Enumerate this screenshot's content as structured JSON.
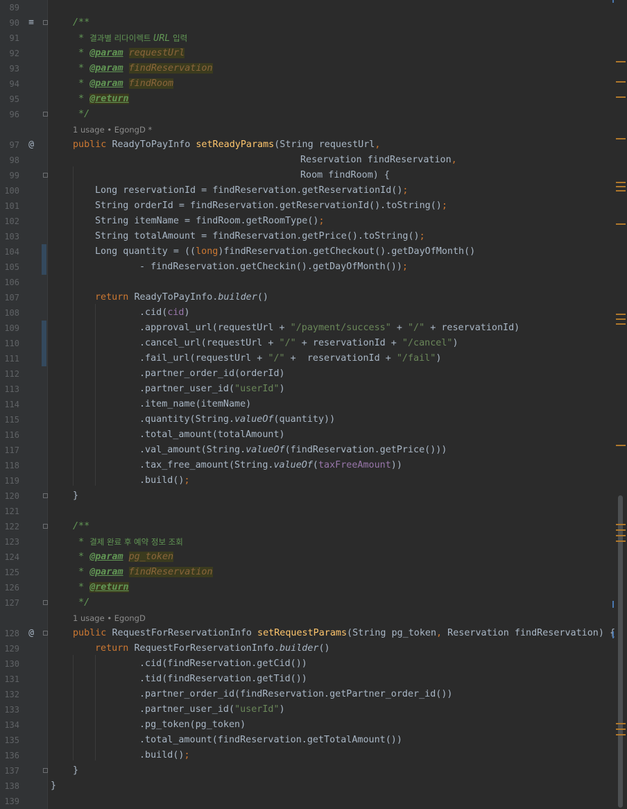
{
  "editor": {
    "hints": {
      "h1": "1 usage   • EgongD *",
      "h2": "1 usage   • EgongD"
    },
    "lines": {
      "l89": "89",
      "l90": "90",
      "l91": "91",
      "l92": "92",
      "l93": "93",
      "l94": "94",
      "l95": "95",
      "l96": "96",
      "l97": "97",
      "l98": "98",
      "l99": "99",
      "l100": "100",
      "l101": "101",
      "l102": "102",
      "l103": "103",
      "l104": "104",
      "l105": "105",
      "l106": "106",
      "l107": "107",
      "l108": "108",
      "l109": "109",
      "l110": "110",
      "l111": "111",
      "l112": "112",
      "l113": "113",
      "l114": "114",
      "l115": "115",
      "l116": "116",
      "l117": "117",
      "l118": "118",
      "l119": "119",
      "l120": "120",
      "l121": "121",
      "l122": "122",
      "l123": "123",
      "l124": "124",
      "l125": "125",
      "l126": "126",
      "l127": "127",
      "l128": "128",
      "l129": "129",
      "l130": "130",
      "l131": "131",
      "l132": "132",
      "l133": "133",
      "l134": "134",
      "l135": "135",
      "l136": "136",
      "l137": "137",
      "l138": "138",
      "l139": "139"
    },
    "t": {
      "c90": "/**",
      "c91a": " * ",
      "c91b": "결과별 리다이렉트 ",
      "c91c": "URL",
      "c91d": " 입력",
      "c92a": " * ",
      "c92b": "@param",
      "c92c": "requestUrl",
      "c93a": " * ",
      "c93b": "@param",
      "c93c": "findReservation",
      "c94a": " * ",
      "c94b": "@param",
      "c94c": "findRoom",
      "c95a": " * ",
      "c95b": "@return",
      "c96": " */",
      "k97": "public ",
      "t97": "ReadyToPayInfo ",
      "f97": "setReadyParams",
      "r97": "(String requestUrl",
      "p97": ",",
      "t98": "Reservation findReservation",
      "p98": ",",
      "t99": "Room findRoom) {",
      "a100": "Long reservationId = findReservation.getReservationId()",
      "b100": ";",
      "a101": "String orderId = findReservation.getReservationId().toString()",
      "b101": ";",
      "a102": "String itemName = findRoom.getRoomType()",
      "b102": ";",
      "a103": "String totalAmount = findReservation.getPrice().toString()",
      "b103": ";",
      "a104": "Long quantity = ((",
      "k104": "long",
      "b104": ")findReservation.getCheckout().getDayOfMonth()",
      "a105": "- findReservation.getCheckin().getDayOfMonth())",
      "b105": ";",
      "k107": "return ",
      "a107": "ReadyToPayInfo.",
      "i107": "builder",
      "b107": "()",
      "a108": ".cid(",
      "f108": "cid",
      "b108": ")",
      "a109": ".approval_url(requestUrl + ",
      "s109a": "\"/payment/success\"",
      "b109": " + ",
      "s109b": "\"/\"",
      "c109": " + reservationId)",
      "a110": ".cancel_url(requestUrl + ",
      "s110a": "\"/\"",
      "b110": " + reservationId + ",
      "s110b": "\"/cancel\"",
      "c110": ")",
      "a111": ".fail_url(requestUrl + ",
      "s111a": "\"/\"",
      "b111": " +  reservationId + ",
      "s111b": "\"/fail\"",
      "c111": ")",
      "a112": ".partner_order_id(orderId)",
      "a113": ".partner_user_id(",
      "s113": "\"userId\"",
      "b113": ")",
      "a114": ".item_name(itemName)",
      "a115": ".quantity(String.",
      "i115": "valueOf",
      "b115": "(quantity))",
      "a116": ".total_amount(totalAmount)",
      "a117": ".val_amount(String.",
      "i117": "valueOf",
      "b117": "(findReservation.getPrice()))",
      "a118": ".tax_free_amount(String.",
      "i118": "valueOf",
      "b118": "(",
      "f118": "taxFreeAmount",
      "c118": "))",
      "a119": ".build()",
      "b119": ";",
      "a120": "}",
      "c122": "/**",
      "c123a": " * ",
      "c123b": "결제 완료 후 예약 정보 조회",
      "c124a": " * ",
      "c124b": "@param",
      "c124c": "pg_token",
      "c125a": " * ",
      "c125b": "@param",
      "c125c": "findReservation",
      "c126a": " * ",
      "c126b": "@return",
      "c127": " */",
      "k128": "public ",
      "t128": "RequestForReservationInfo ",
      "f128": "setRequestParams",
      "r128": "(String pg_token",
      "p128": ", ",
      "q128": "Reservation findReservation) {",
      "k129": "return ",
      "a129": "RequestForReservationInfo.",
      "i129": "builder",
      "b129": "()",
      "a130": ".cid(findReservation.getCid())",
      "a131": ".tid(findReservation.getTid())",
      "a132": ".partner_order_id(findReservation.getPartner_order_id())",
      "a133": ".partner_user_id(",
      "s133": "\"userId\"",
      "b133": ")",
      "a134": ".pg_token(pg_token)",
      "a135": ".total_amount(findReservation.getTotalAmount())",
      "a136": ".build()",
      "b136": ";",
      "a137": "}",
      "a138": "}"
    }
  }
}
